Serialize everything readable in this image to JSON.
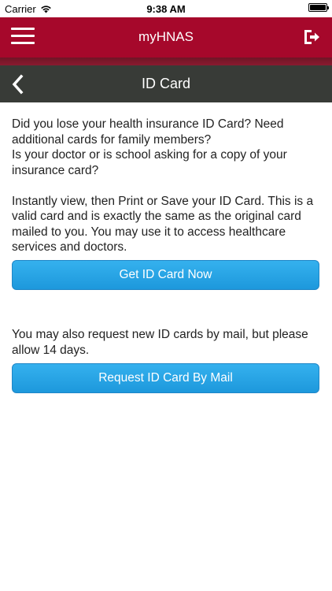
{
  "status_bar": {
    "carrier": "Carrier",
    "time": "9:38 AM",
    "battery_level": 1.0
  },
  "app_header": {
    "title": "myHNAS",
    "menu_icon": "hamburger-icon",
    "logout_icon": "logout-icon",
    "color": "#a6082b"
  },
  "nav_bar": {
    "title": "ID Card",
    "back_icon": "chevron-left-icon",
    "color": "#383b37"
  },
  "content": {
    "intro_1": "Did you lose your health insurance ID Card? Need additional cards for family members?",
    "intro_2": "Is your doctor or is school asking for a copy of your insurance card?",
    "instant_text": "Instantly view, then Print or Save your ID Card. This is a valid card and is exactly the same as the original card mailed to you. You may use it to access healthcare services and doctors.",
    "get_card_button": "Get ID Card Now",
    "mail_text": "You may also request new ID cards by mail, but please allow 14 days.",
    "mail_button": "Request ID Card By Mail",
    "button_color": "#1d98dc"
  }
}
